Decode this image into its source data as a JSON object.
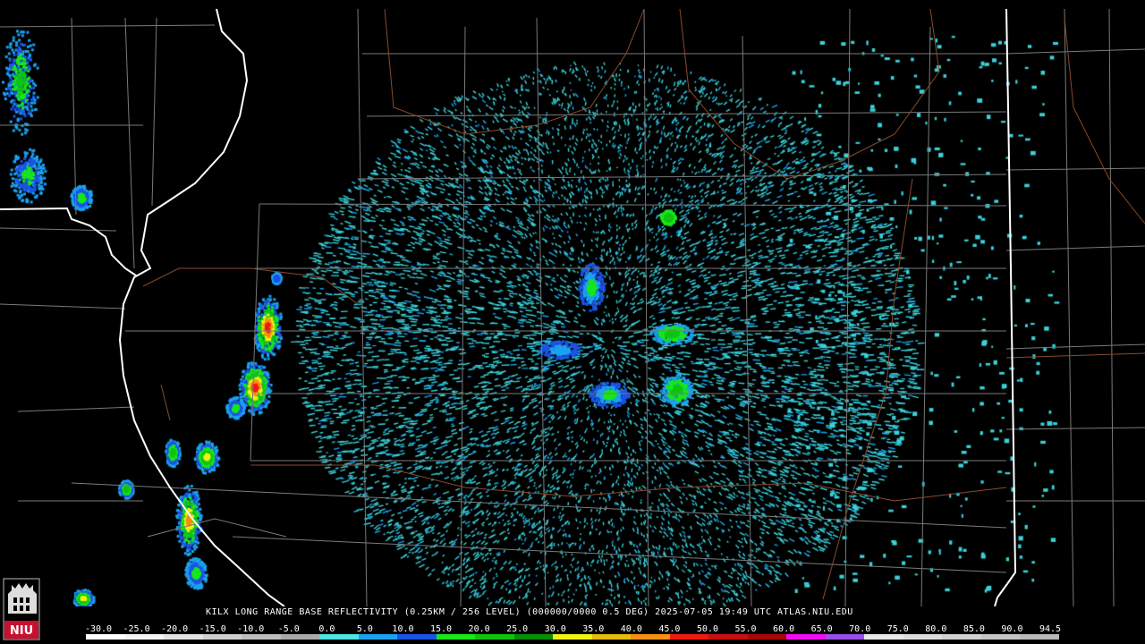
{
  "caption": "KILX LONG RANGE BASE REFLECTIVITY (0.25KM / 256 LEVEL) (000000/0000 0.5 DEG) 2025-07-05 19:49 UTC  ATLAS.NIU.EDU",
  "logo_text": "NIU",
  "legend": {
    "labels": [
      "-30.0",
      "-25.0",
      "-20.0",
      "-15.0",
      "-10.0",
      "-5.0",
      "0.0",
      "5.0",
      "10.0",
      "15.0",
      "20.0",
      "25.0",
      "30.0",
      "35.0",
      "40.0",
      "45.0",
      "50.0",
      "55.0",
      "60.0",
      "65.0",
      "70.0",
      "75.0",
      "80.0",
      "85.0",
      "90.0",
      "94.5"
    ],
    "colors": [
      "#ffffff",
      "#f4f4f4",
      "#e2e2e2",
      "#cfcfcf",
      "#bdbdbd",
      "#a9a9a9",
      "#4fe3e3",
      "#1aa3f0",
      "#1b53e8",
      "#17e817",
      "#0fc40f",
      "#078f07",
      "#f2f20f",
      "#e5bd0a",
      "#f58f0f",
      "#f0190f",
      "#c80e0e",
      "#a80505",
      "#f50af5",
      "#9a4ee6",
      "#e8e8e8",
      "#dcdcdc",
      "#d0d0d0",
      "#c4c4c4",
      "#b8b8b8"
    ]
  },
  "colors": {
    "background": "#000000",
    "county_lines": "#7a7a7a",
    "state_lines": "#ffffff",
    "highways": "#8b4a2a",
    "light_echo": "#3ad1d9"
  }
}
